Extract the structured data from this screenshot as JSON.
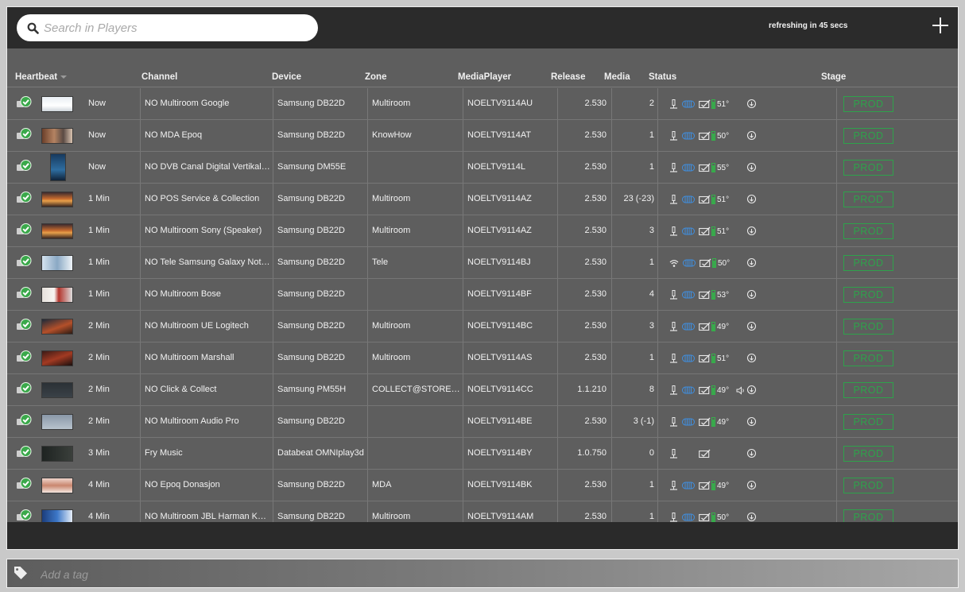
{
  "search": {
    "placeholder": "Search in Players"
  },
  "refresh": {
    "text": "refreshing in 45 secs"
  },
  "tag_input": {
    "placeholder": "Add a tag"
  },
  "columns": {
    "heartbeat": "Heartbeat",
    "channel": "Channel",
    "device": "Device",
    "zone": "Zone",
    "mediaplayer": "MediaPlayer",
    "release": "Release",
    "media": "Media",
    "status": "Status",
    "stage": "Stage"
  },
  "colors": {
    "stage_prod": "#2ea24b",
    "status_ok": "#3aa84a",
    "link_blue": "#3f8fe0",
    "battery_green": "#35b04a"
  },
  "rows": [
    {
      "heartbeat": "Now",
      "channel": "NO Multiroom Google",
      "device": "Samsung DB22D",
      "zone": "Multiroom",
      "mediaplayer": "NOELTV9114AU",
      "release": "2.530",
      "media": "2",
      "network": "ethernet",
      "temp": "51°",
      "sound": false,
      "stage": "PROD",
      "thumb": "white-screen"
    },
    {
      "heartbeat": "Now",
      "channel": "NO MDA Epoq",
      "device": "Samsung DB22D",
      "zone": "KnowHow",
      "mediaplayer": "NOELTV9114AT",
      "release": "2.530",
      "media": "1",
      "network": "ethernet",
      "temp": "50°",
      "sound": false,
      "stage": "PROD",
      "thumb": "interior"
    },
    {
      "heartbeat": "Now",
      "channel": "NO DVB Canal Digital Vertikal ...",
      "device": "Samsung DM55E",
      "zone": "",
      "mediaplayer": "NOELTV9114L",
      "release": "2.530",
      "media": "1",
      "network": "ethernet",
      "temp": "55°",
      "sound": false,
      "stage": "PROD",
      "thumb": "portrait"
    },
    {
      "heartbeat": "1 Min",
      "channel": "NO POS Service & Collection",
      "device": "Samsung DB22D",
      "zone": "Multiroom",
      "mediaplayer": "NOELTV9114AZ",
      "release": "2.530",
      "media": "23 (-23)",
      "network": "ethernet",
      "temp": "51°",
      "sound": false,
      "stage": "PROD",
      "thumb": "sunset"
    },
    {
      "heartbeat": "1 Min",
      "channel": "NO Multiroom Sony (Speaker)",
      "device": "Samsung DB22D",
      "zone": "Multiroom",
      "mediaplayer": "NOELTV9114AZ",
      "release": "2.530",
      "media": "3",
      "network": "ethernet",
      "temp": "51°",
      "sound": false,
      "stage": "PROD",
      "thumb": "sunset"
    },
    {
      "heartbeat": "1 Min",
      "channel": "NO Tele Samsung Galaxy Note ...",
      "device": "Samsung DB22D",
      "zone": "Tele",
      "mediaplayer": "NOELTV9114BJ",
      "release": "2.530",
      "media": "1",
      "network": "wifi",
      "temp": "50°",
      "sound": false,
      "stage": "PROD",
      "thumb": "light-blue"
    },
    {
      "heartbeat": "1 Min",
      "channel": "NO Multiroom Bose",
      "device": "Samsung DB22D",
      "zone": "",
      "mediaplayer": "NOELTV9114BF",
      "release": "2.530",
      "media": "4",
      "network": "ethernet",
      "temp": "53°",
      "sound": false,
      "stage": "PROD",
      "thumb": "room"
    },
    {
      "heartbeat": "2 Min",
      "channel": "NO Multiroom UE Logitech",
      "device": "Samsung DB22D",
      "zone": "Multiroom",
      "mediaplayer": "NOELTV9114BC",
      "release": "2.530",
      "media": "3",
      "network": "ethernet",
      "temp": "49°",
      "sound": false,
      "stage": "PROD",
      "thumb": "dark-orange"
    },
    {
      "heartbeat": "2 Min",
      "channel": "NO Multiroom Marshall",
      "device": "Samsung DB22D",
      "zone": "Multiroom",
      "mediaplayer": "NOELTV9114AS",
      "release": "2.530",
      "media": "1",
      "network": "ethernet",
      "temp": "51°",
      "sound": false,
      "stage": "PROD",
      "thumb": "dark-red"
    },
    {
      "heartbeat": "2 Min",
      "channel": "NO Click & Collect",
      "device": "Samsung PM55H",
      "zone": "COLLECT@STORE SH...",
      "mediaplayer": "NOELTV9114CC",
      "release": "1.1.210",
      "media": "8",
      "network": "ethernet",
      "temp": "49°",
      "sound": true,
      "stage": "PROD",
      "thumb": "dark-text"
    },
    {
      "heartbeat": "2 Min",
      "channel": "NO Multiroom Audio Pro",
      "device": "Samsung DB22D",
      "zone": "",
      "mediaplayer": "NOELTV9114BE",
      "release": "2.530",
      "media": "3 (-1)",
      "network": "ethernet",
      "temp": "49°",
      "sound": false,
      "stage": "PROD",
      "thumb": "grey-blue"
    },
    {
      "heartbeat": "3 Min",
      "channel": "Fry Music",
      "device": "Databeat OMNIplay3d",
      "zone": "",
      "mediaplayer": "NOELTV9114BY",
      "release": "1.0.750",
      "media": "0",
      "network": "ethernet-only",
      "temp": "",
      "sound": false,
      "stage": "PROD",
      "thumb": "dark-grey"
    },
    {
      "heartbeat": "4 Min",
      "channel": "NO Epoq Donasjon",
      "device": "Samsung DB22D",
      "zone": "MDA",
      "mediaplayer": "NOELTV9114BK",
      "release": "2.530",
      "media": "1",
      "network": "ethernet",
      "temp": "49°",
      "sound": false,
      "stage": "PROD",
      "thumb": "pink-room"
    },
    {
      "heartbeat": "4 Min",
      "channel": "NO Multiroom JBL Harman Kar...",
      "device": "Samsung DB22D",
      "zone": "Multiroom",
      "mediaplayer": "NOELTV9114AM",
      "release": "2.530",
      "media": "1",
      "network": "ethernet",
      "temp": "50°",
      "sound": false,
      "stage": "PROD",
      "thumb": "blue-screen"
    }
  ]
}
